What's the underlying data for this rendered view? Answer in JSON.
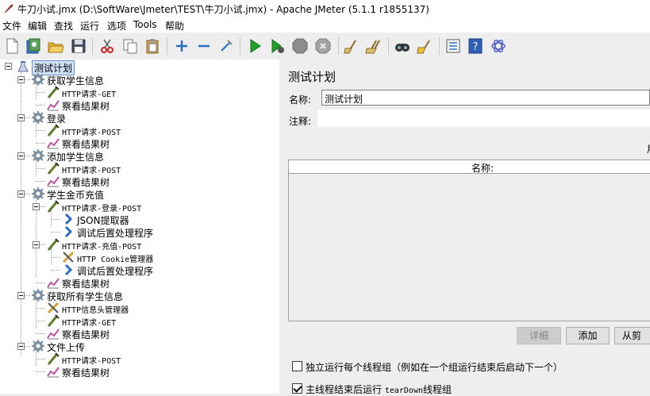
{
  "window": {
    "title": "牛刀小试.jmx (D:\\SoftWare\\Jmeter\\TEST\\牛刀小试.jmx) - Apache JMeter (5.1.1 r1855137)"
  },
  "menu": [
    "文件",
    "编辑",
    "查找",
    "运行",
    "选项",
    "Tools",
    "帮助"
  ],
  "toolbar": [
    "new-icon",
    "templates-icon",
    "open-icon",
    "save-icon",
    "cut-icon",
    "copy-icon",
    "paste-icon",
    "expand-icon",
    "collapse-icon",
    "toggle-icon",
    "start-icon",
    "start-no-pauses-icon",
    "stop-icon",
    "shutdown-icon",
    "clear-icon",
    "clear-all-icon",
    "search-icon",
    "reset-search-icon",
    "function-helper-icon",
    "help-icon",
    "logger-icon"
  ],
  "tree": {
    "root": "测试计划",
    "groups": [
      {
        "label": "获取学生信息",
        "children": [
          {
            "type": "http",
            "label": "HTTP请求-GET"
          },
          {
            "type": "listener",
            "label": "察看结果树"
          }
        ]
      },
      {
        "label": "登录",
        "children": [
          {
            "type": "http",
            "label": "HTTP请求-POST"
          },
          {
            "type": "listener",
            "label": "察看结果树"
          }
        ]
      },
      {
        "label": "添加学生信息",
        "children": [
          {
            "type": "http",
            "label": "HTTP请求-POST"
          },
          {
            "type": "listener",
            "label": "察看结果树"
          }
        ]
      },
      {
        "label": "学生金币充值",
        "children": [
          {
            "type": "http",
            "label": "HTTP请求-登录-POST",
            "children": [
              {
                "type": "post",
                "label": "JSON提取器"
              },
              {
                "type": "post",
                "label": "调试后置处理程序"
              }
            ]
          },
          {
            "type": "http",
            "label": "HTTP请求-充值-POST",
            "children": [
              {
                "type": "config",
                "label": "HTTP Cookie管理器"
              },
              {
                "type": "post",
                "label": "调试后置处理程序"
              }
            ]
          },
          {
            "type": "listener",
            "label": "察看结果树"
          }
        ]
      },
      {
        "label": "获取所有学生信息",
        "children": [
          {
            "type": "config",
            "label": "HTTP信息头管理器"
          },
          {
            "type": "http",
            "label": "HTTP请求-GET"
          },
          {
            "type": "listener",
            "label": "察看结果树"
          }
        ]
      },
      {
        "label": "文件上传",
        "children": [
          {
            "type": "http",
            "label": "HTTP请求-POST"
          },
          {
            "type": "listener",
            "label": "察看结果树"
          }
        ]
      }
    ]
  },
  "panel": {
    "title": "测试计划",
    "name_label": "名称:",
    "name_value": "测试计划",
    "comment_label": "注释:",
    "comment_value": "",
    "side_label": "用",
    "table_header": "名称:",
    "buttons": {
      "detail": "详细",
      "add": "添加",
      "add_from_clipboard": "从剪"
    },
    "checkbox_serial": {
      "label": "独立运行每个线程组（例如在一个组运行结束后启动下一个）",
      "checked": false
    },
    "checkbox_teardown": {
      "label_prefix": "主线程结束后运行 ",
      "label_mono": "tearDown",
      "label_suffix": "线程组",
      "checked": true
    }
  }
}
